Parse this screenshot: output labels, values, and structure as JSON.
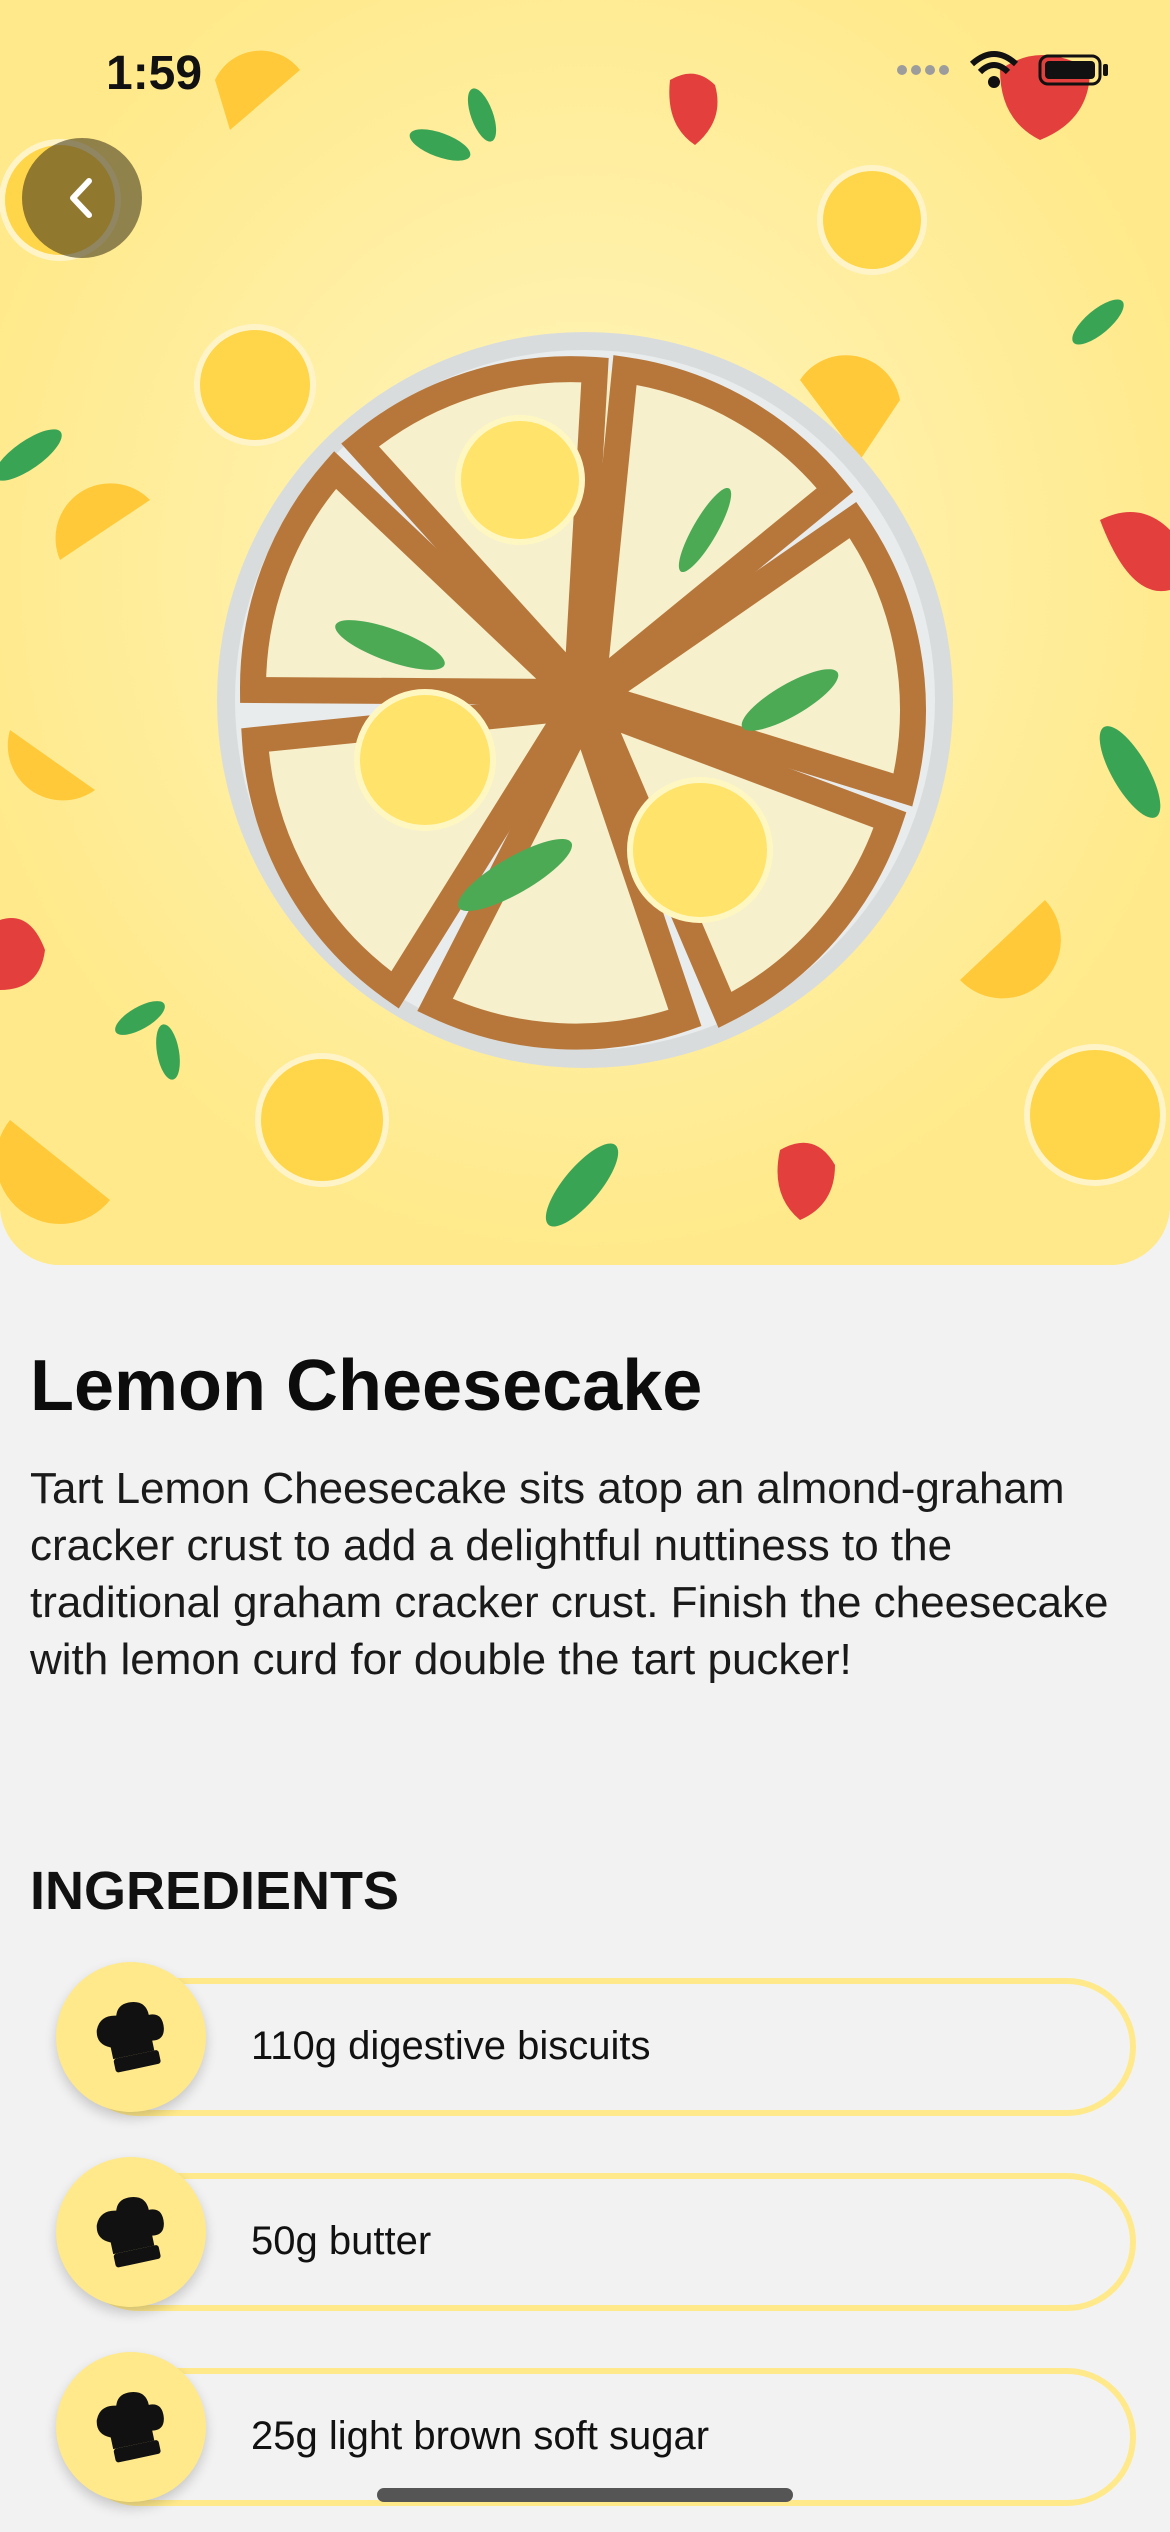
{
  "status_bar": {
    "time": "1:59"
  },
  "recipe": {
    "title": "Lemon Cheesecake",
    "description": "Tart Lemon Cheesecake sits atop an almond-graham cracker crust to add a delightful nuttiness to the traditional graham cracker crust. Finish the cheesecake with lemon curd for double the tart pucker!"
  },
  "ingredients": {
    "heading": "INGREDIENTS",
    "items": [
      {
        "label": "110g digestive biscuits",
        "icon": "chef-hat-icon"
      },
      {
        "label": "50g butter",
        "icon": "chef-hat-icon"
      },
      {
        "label": "25g light brown soft sugar",
        "icon": "chef-hat-icon"
      }
    ]
  },
  "colors": {
    "accent": "#ffe98a",
    "background": "#f2f2f2"
  }
}
